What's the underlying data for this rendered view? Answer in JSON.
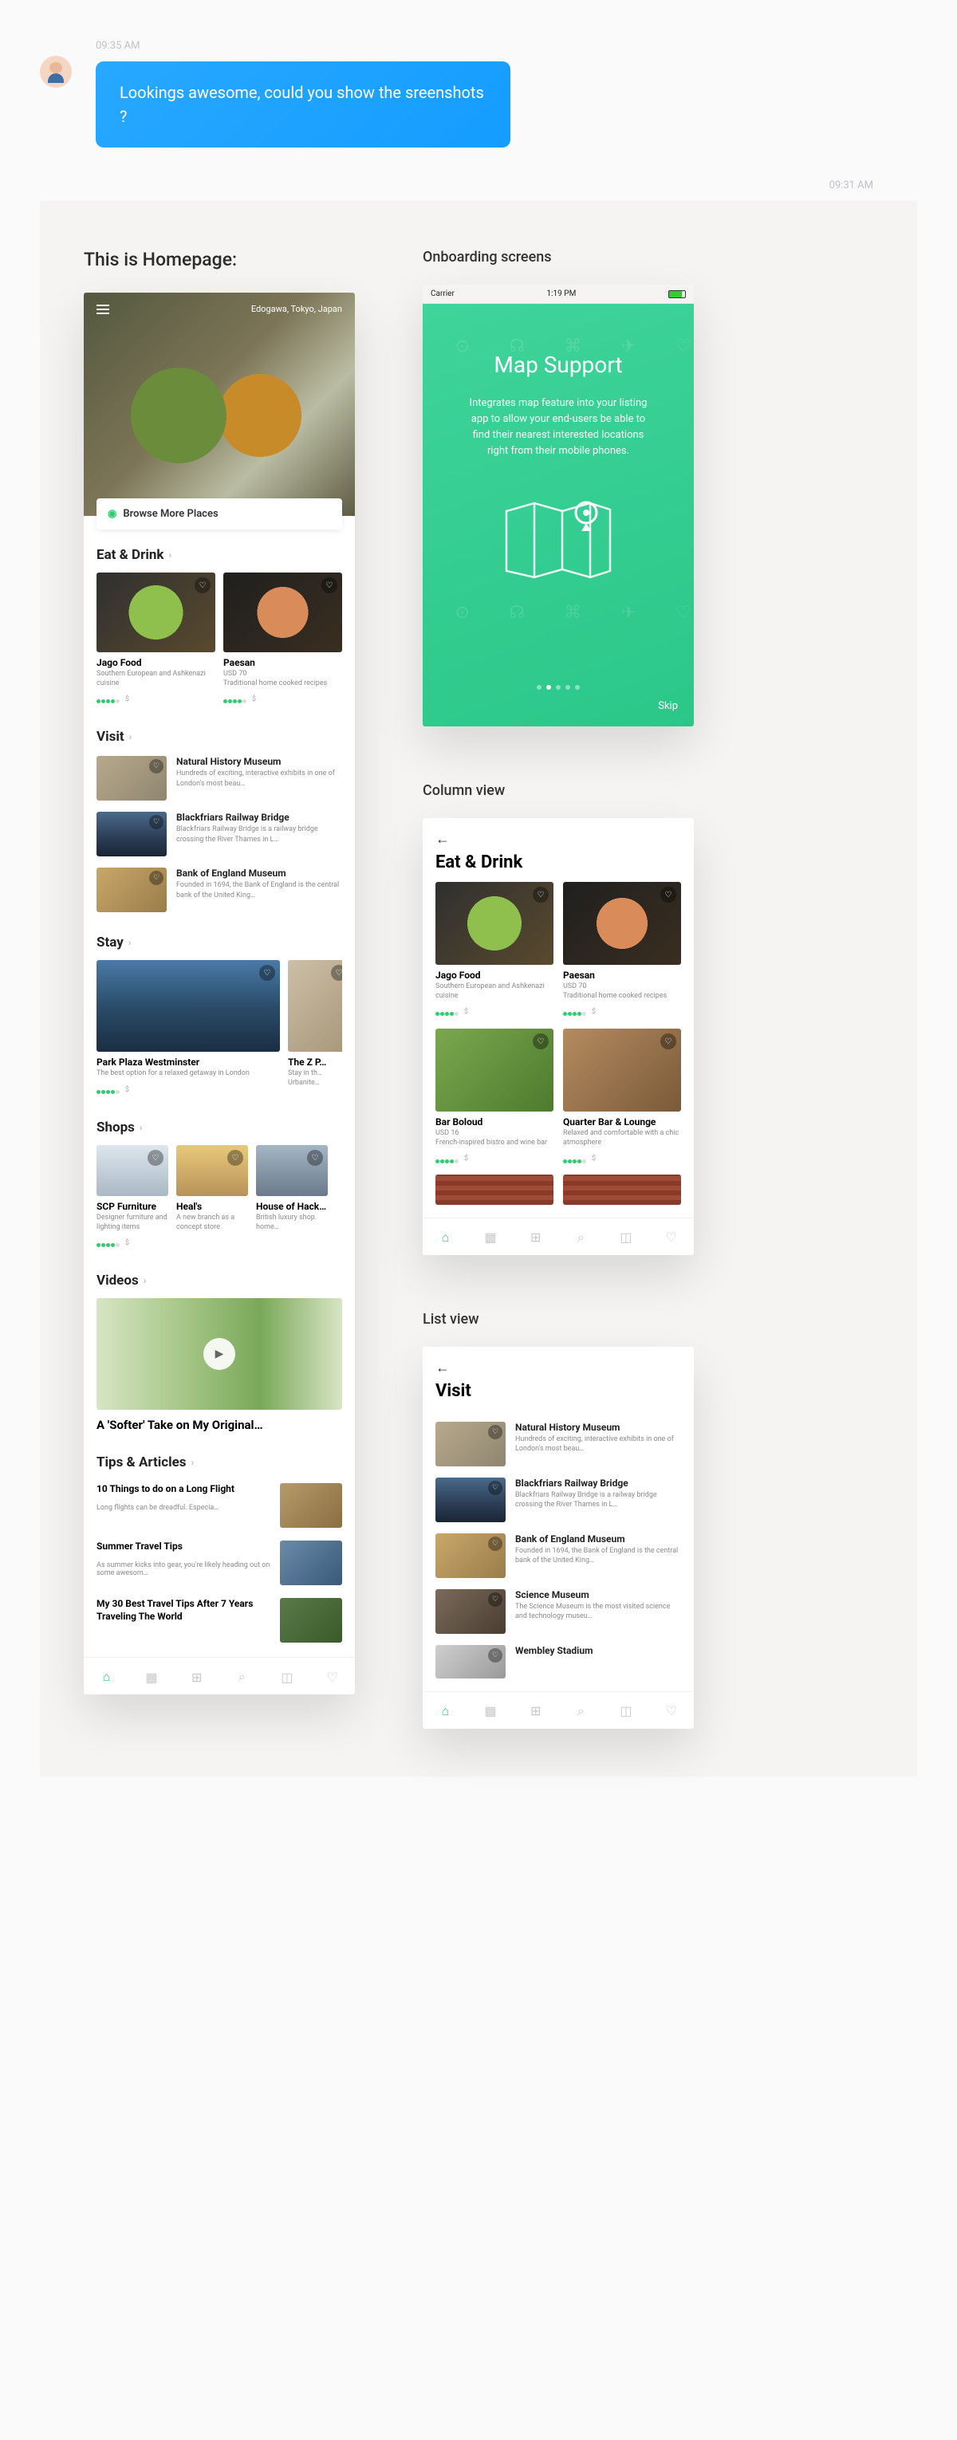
{
  "chat": {
    "sender_time": "09:35 AM",
    "bubble": "Lookings awesome, could you show the sreenshots ?",
    "reply_time": "09:31 AM"
  },
  "homepage": {
    "label": "This is Homepage:",
    "location": "Edogawa, Tokyo, Japan",
    "browse": "Browse More Places",
    "eat_drink": {
      "title": "Eat & Drink",
      "items": [
        {
          "name": "Jago Food",
          "desc": "Southern European and Ashkenazi cuisine",
          "rating": 4,
          "count": "$"
        },
        {
          "name": "Paesan",
          "desc": "USD 70\nTraditional home cooked recipes",
          "rating": 4,
          "count": "$"
        }
      ]
    },
    "visit": {
      "title": "Visit",
      "items": [
        {
          "name": "Natural History Museum",
          "desc": "Hundreds of exciting, interactive exhibits in one of London's most beau…"
        },
        {
          "name": "Blackfriars Railway Bridge",
          "desc": "Blackfriars Railway Bridge is a railway bridge crossing the River Thames in L…"
        },
        {
          "name": "Bank of England Museum",
          "desc": "Founded in 1694, the Bank of England is the central bank of the United King…"
        }
      ]
    },
    "stay": {
      "title": "Stay",
      "items": [
        {
          "name": "Park Plaza Westminster",
          "desc": "The best option for a relaxed getaway in London",
          "rating": 4,
          "count": "$"
        },
        {
          "name": "The Z P…",
          "desc": "Stay in th… Urbanite…"
        }
      ]
    },
    "shops": {
      "title": "Shops",
      "items": [
        {
          "name": "SCP Furniture",
          "desc": "Designer furniture and lighting items",
          "rating": 4,
          "count": "$"
        },
        {
          "name": "Heal's",
          "desc": "A new branch as a concept store"
        },
        {
          "name": "House of Hack…",
          "desc": "British luxury shop. home…"
        }
      ]
    },
    "videos": {
      "title": "Videos",
      "item": {
        "title": "A 'Softer' Take on My Original…"
      }
    },
    "tips": {
      "title": "Tips & Articles",
      "items": [
        {
          "title": "10 Things to do on a Long Flight",
          "desc": "Long flights can be dreadful. Especia…"
        },
        {
          "title": "Summer Travel Tips",
          "desc": "As summer kicks into gear, you're likely heading out on some awesom…"
        },
        {
          "title": "My 30 Best Travel Tips After 7 Years Traveling The World",
          "desc": ""
        }
      ]
    }
  },
  "onboarding": {
    "heading": "Onboarding screens",
    "status": {
      "carrier": "Carrier",
      "time": "1:19 PM"
    },
    "title": "Map Support",
    "desc": "Integrates map feature into your listing app to allow your end-users be able to find their nearest interested locations right from their mobile phones.",
    "skip": "Skip"
  },
  "column_view": {
    "heading": "Column view",
    "title": "Eat & Drink",
    "items": [
      {
        "name": "Jago Food",
        "desc": "Southern European and Ashkenazi cuisine",
        "rating": 4,
        "count": "$"
      },
      {
        "name": "Paesan",
        "desc": "USD 70\nTraditional home cooked recipes",
        "rating": 4,
        "count": "$"
      },
      {
        "name": "Bar Boloud",
        "desc": "USD 16\nFrench-inspired bistro and wine bar",
        "rating": 4,
        "count": "$"
      },
      {
        "name": "Quarter Bar & Lounge",
        "desc": "Relaxed and comfortable with a chic atmosphere",
        "rating": 4,
        "count": "$"
      }
    ]
  },
  "list_view": {
    "heading": "List view",
    "title": "Visit",
    "items": [
      {
        "name": "Natural History Museum",
        "desc": "Hundreds of exciting, interactive exhibits in one of London's most beau…"
      },
      {
        "name": "Blackfriars Railway Bridge",
        "desc": "Blackfriars Railway Bridge is a railway bridge crossing the River Thames in L…"
      },
      {
        "name": "Bank of England Museum",
        "desc": "Founded in 1694, the Bank of England is the central bank of the United King…"
      },
      {
        "name": "Science Museum",
        "desc": "The Science Museum is the most visited science and technology museu…"
      },
      {
        "name": "Wembley Stadium",
        "desc": ""
      }
    ]
  }
}
